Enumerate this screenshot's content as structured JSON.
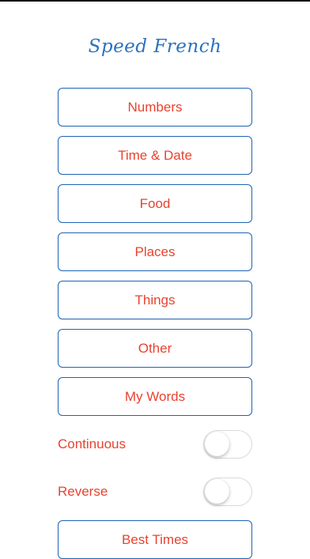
{
  "app": {
    "title": "Speed French"
  },
  "menu": {
    "items": [
      {
        "label": "Numbers"
      },
      {
        "label": "Time & Date"
      },
      {
        "label": "Food"
      },
      {
        "label": "Places"
      },
      {
        "label": "Things"
      },
      {
        "label": "Other"
      },
      {
        "label": "My Words"
      }
    ]
  },
  "options": {
    "continuous": {
      "label": "Continuous",
      "on": false
    },
    "reverse": {
      "label": "Reverse",
      "on": false
    }
  },
  "footer": {
    "best_times_label": "Best Times"
  },
  "colors": {
    "title": "#2a72bd",
    "button_border": "#1f63b0",
    "button_text": "#e8432f",
    "switch_border": "#d9d9d9"
  }
}
